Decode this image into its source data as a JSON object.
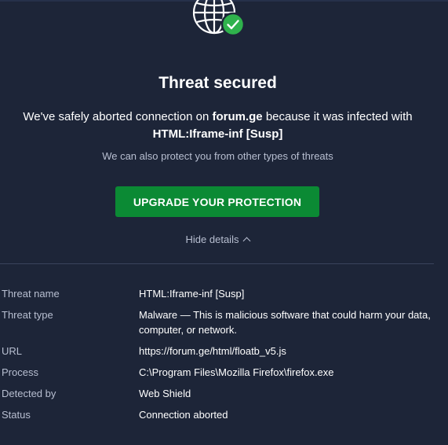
{
  "header": {
    "title": "Threat secured",
    "message_prefix": "We've safely aborted connection on",
    "message_site": "forum.ge",
    "message_middle": "because it was infected with",
    "message_threat": "HTML:Iframe-inf [Susp]",
    "sub_text": "We can also protect you from other types of threats"
  },
  "actions": {
    "upgrade_label": "UPGRADE YOUR PROTECTION",
    "hide_details_label": "Hide details"
  },
  "details": {
    "threat_name_label": "Threat name",
    "threat_name_value": "HTML:Iframe-inf [Susp]",
    "threat_type_label": "Threat type",
    "threat_type_value": "Malware — This is malicious software that could harm your data, computer, or network.",
    "url_label": "URL",
    "url_value": "https://forum.ge/html/floatb_v5.js",
    "process_label": "Process",
    "process_value": "C:\\Program Files\\Mozilla Firefox\\firefox.exe",
    "detected_by_label": "Detected by",
    "detected_by_value": "Web Shield",
    "status_label": "Status",
    "status_value": "Connection aborted"
  },
  "icons": {
    "hero": "globe-icon",
    "check": "check-badge-icon"
  },
  "colors": {
    "background": "#1d2538",
    "accent_green": "#0b8a34",
    "badge_green": "#2fb24c"
  }
}
